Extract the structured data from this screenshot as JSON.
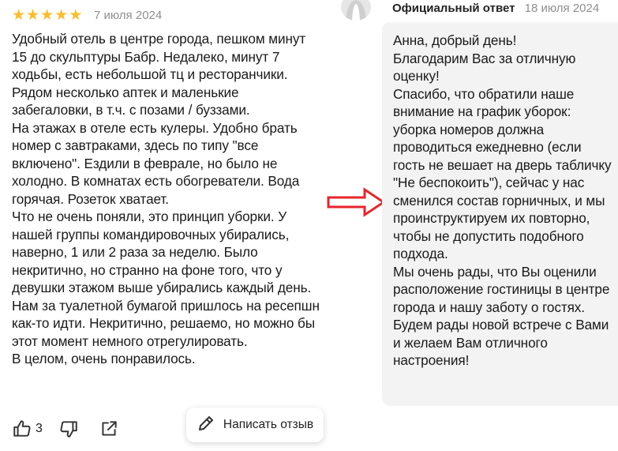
{
  "review": {
    "rating": 5,
    "star_color": "#fbbe2a",
    "date": "7 июля 2024",
    "text": "Удобный отель в центре города, пешком минут 15 до скульптуры Бабр. Недалеко, минут 7 ходьбы, есть небольшой тц и ресторанчики. Рядом несколько аптек и маленькие забегаловки, в т.ч. с позами / буззами.\nНа этажах в отеле есть кулеры. Удобно брать номер с завтраками, здесь по типу \"все включено\". Ездили в феврале, но было не холодно. В комнатах есть обогреватели. Вода горячая. Розеток хватает.\nЧто не очень поняли, это принцип уборки. У нашей группы командировочных убирались, наверно, 1 или 2 раза за неделю. Было некритично, но странно на фоне того, что у девушки этажом выше убирались каждый день. Нам за туалетной бумагой пришлось на ресепшн как-то идти. Некритично, решаемо, но можно бы этот момент немного отрегулировать.\nВ целом, очень понравилось."
  },
  "actions": {
    "like_icon": "thumbs-up-icon",
    "like_count": "3",
    "dislike_icon": "thumbs-down-icon",
    "share_icon": "share-icon",
    "write_review_icon": "pencil-icon",
    "write_review_label": "Написать отзыв"
  },
  "annotation": {
    "arrow_icon": "red-arrow-right-icon",
    "arrow_color": "#e8252b"
  },
  "reply": {
    "title": "Официальный ответ",
    "date": "18 июля 2024",
    "text": "Анна, добрый день!\nБлагодарим Вас за отличную оценку!\nСпасибо, что обратили наше внимание на график уборок: уборка номеров должна проводиться ежедневно (если гость не вешает на дверь табличку \"Не беспокоить\"), сейчас у нас сменился состав горничных, и мы проинструктируем их повторно, чтобы не допустить подобного подхода.\nМы очень рады, что Вы оценили расположение гостиницы в центре города и нашу заботу о гостях. Будем рады новой встрече с Вами и желаем Вам отличного настроения!"
  }
}
